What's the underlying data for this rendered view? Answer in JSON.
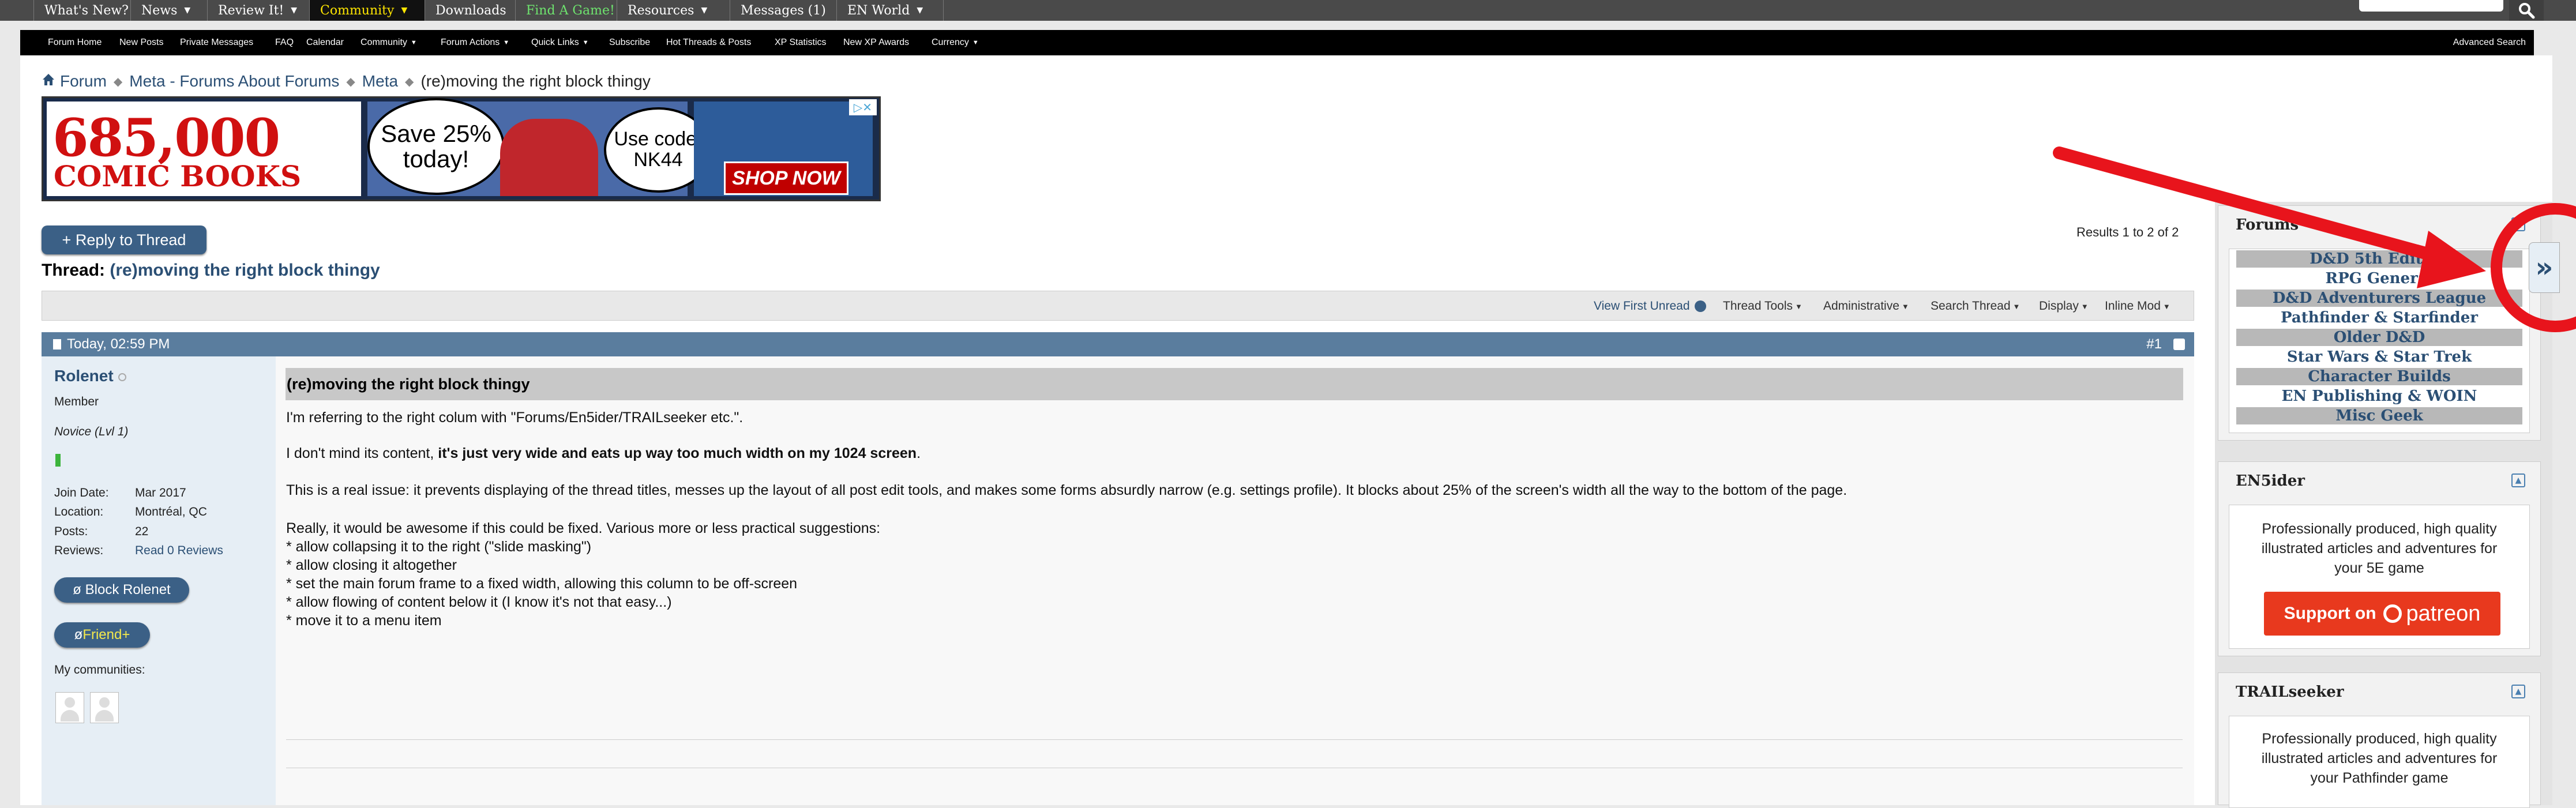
{
  "topnav": {
    "tabs": [
      {
        "label": "What's New?",
        "caret": ""
      },
      {
        "label": "News",
        "caret": "▼"
      },
      {
        "label": "Review It!",
        "caret": "▼"
      },
      {
        "label": "Community",
        "caret": "▼"
      },
      {
        "label": "Downloads",
        "caret": ""
      },
      {
        "label": "Find A Game!",
        "caret": ""
      },
      {
        "label": "Resources",
        "caret": "▼"
      },
      {
        "label": "Messages (1)",
        "caret": ""
      },
      {
        "label": "EN World",
        "caret": "▼"
      }
    ],
    "search_icon": "search-icon"
  },
  "subnav": {
    "items": [
      {
        "label": "Forum Home",
        "caret": ""
      },
      {
        "label": "New Posts",
        "caret": ""
      },
      {
        "label": "Private Messages",
        "caret": ""
      },
      {
        "label": "FAQ",
        "caret": ""
      },
      {
        "label": "Calendar",
        "caret": ""
      },
      {
        "label": "Community",
        "caret": "▼"
      },
      {
        "label": "Forum Actions",
        "caret": "▼"
      },
      {
        "label": "Quick Links",
        "caret": "▼"
      },
      {
        "label": "Subscribe",
        "caret": ""
      },
      {
        "label": "Hot Threads & Posts",
        "caret": ""
      },
      {
        "label": "XP Statistics",
        "caret": ""
      },
      {
        "label": "New XP Awards",
        "caret": ""
      },
      {
        "label": "Currency",
        "caret": "▼"
      }
    ],
    "advanced_search": "Advanced Search"
  },
  "breadcrumb": {
    "items": [
      "Forum",
      "Meta - Forums About Forums",
      "Meta"
    ],
    "current": "(re)moving the right block thingy"
  },
  "banner": {
    "count": "685,000",
    "subtitle": "COMIC BOOKS",
    "save": "Save 25% today!",
    "code_label": "Use code:",
    "code": "NK44",
    "shop": "SHOP NOW"
  },
  "reply_button": "+ Reply to Thread",
  "results": "Results 1 to 2 of 2",
  "thread": {
    "label": "Thread:",
    "title": "(re)moving the right block thingy"
  },
  "toolbar": {
    "view_first_unread": "View First Unread",
    "items": [
      "Thread Tools",
      "Administrative",
      "Search Thread",
      "Display",
      "Inline Mod"
    ]
  },
  "post": {
    "date": "Today, 02:59 PM",
    "number": "#1",
    "user": {
      "name": "Rolenet",
      "title": "Member",
      "rank": "Novice (Lvl 1)",
      "info": [
        {
          "key": "Join Date:",
          "value": "Mar 2017"
        },
        {
          "key": "Location:",
          "value": "Montréal, QC"
        },
        {
          "key": "Posts:",
          "value": "22"
        },
        {
          "key": "Reviews:",
          "value": "Read 0 Reviews"
        }
      ],
      "block_button": "ø Block Rolenet",
      "friend_prefix": "ø ",
      "friend_label": "Friend+",
      "communities_label": "My communities:"
    },
    "title": "(re)moving the right block thingy",
    "line1": "I'm referring to the right colum with \"Forums/En5ider/TRAILseeker etc.\".",
    "line2_pre": "I don't mind its content, ",
    "line2_bold": "it's just very wide and eats up way too much width on my 1024 screen",
    "line2_post": ".",
    "line3": "This is a real issue: it prevents displaying of the thread titles, messes up the layout of all post edit tools, and makes some forms absurdly narrow (e.g. settings profile). It blocks about 25% of the screen's width all the way to the bottom of the page.",
    "suggestions": [
      "Really, it would be awesome if this could be fixed. Various more or less practical suggestions:",
      "* allow collapsing it to the right (\"slide masking\")",
      "* allow closing it altogether",
      "* set the main forum frame to a fixed width, allowing this column to be off-screen",
      "* allow flowing of content below it (I know it's not that easy...)",
      "* move it to a menu item"
    ]
  },
  "sidebar": {
    "forums": {
      "title": "Forums",
      "links": [
        "D&D 5th Edition",
        "RPG General",
        "D&D Adventurers League",
        "Pathfinder & Starfinder",
        "Older D&D",
        "Star Wars & Star Trek",
        "Character Builds",
        "EN Publishing & WOIN",
        "Misc Geek"
      ]
    },
    "en5ider": {
      "title": "EN5ider",
      "desc": [
        "Professionally produced, high quality",
        "illustrated articles and adventures for",
        "your 5E game"
      ],
      "patreon_prefix": "Support on",
      "patreon_name": "patreon"
    },
    "trailseeker": {
      "title": "TRAILseeker",
      "desc": [
        "Professionally produced, high quality",
        "illustrated articles and adventures for",
        "your Pathfinder game"
      ]
    },
    "expand_glyph": "»"
  },
  "colors": {
    "nav": "#4a4a4a",
    "accent": "#3b6086",
    "link": "#2b4f74",
    "annotation": "#e8141c"
  }
}
